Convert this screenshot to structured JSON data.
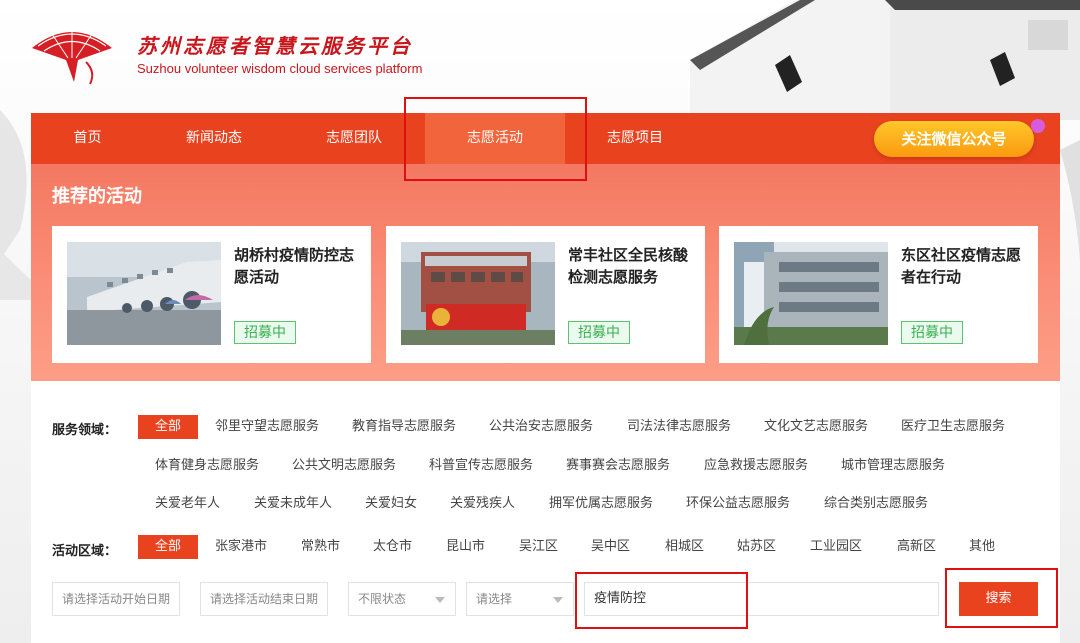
{
  "header": {
    "title_cn": "苏州志愿者智慧云服务平台",
    "title_en": "Suzhou volunteer wisdom cloud services platform",
    "logo_icon": "fan-logo-icon"
  },
  "nav": {
    "items": [
      {
        "label": "首页"
      },
      {
        "label": "新闻动态"
      },
      {
        "label": "志愿团队"
      },
      {
        "label": "志愿活动"
      },
      {
        "label": "志愿项目"
      }
    ],
    "active_index": 3,
    "wechat_button": "关注微信公众号"
  },
  "recommended": {
    "title": "推荐的活动",
    "cards": [
      {
        "title": "胡桥村疫情防控志愿活动",
        "status": "招募中"
      },
      {
        "title": "常丰社区全民核酸检测志愿服务",
        "status": "招募中"
      },
      {
        "title": "东区社区疫情志愿者在行动",
        "status": "招募中"
      }
    ]
  },
  "filters": {
    "service_label": "服务领域：",
    "service_all": "全部",
    "service_row1": [
      "邻里守望志愿服务",
      "教育指导志愿服务",
      "公共治安志愿服务",
      "司法法律志愿服务",
      "文化文艺志愿服务",
      "医疗卫生志愿服务"
    ],
    "service_row2": [
      "体育健身志愿服务",
      "公共文明志愿服务",
      "科普宣传志愿服务",
      "赛事赛会志愿服务",
      "应急救援志愿服务",
      "城市管理志愿服务"
    ],
    "service_row3": [
      "关爱老年人",
      "关爱未成年人",
      "关爱妇女",
      "关爱残疾人",
      "拥军优属志愿服务",
      "环保公益志愿服务",
      "综合类别志愿服务"
    ],
    "area_label": "活动区域：",
    "area_all": "全部",
    "areas": [
      "张家港市",
      "常熟市",
      "太仓市",
      "昆山市",
      "吴江区",
      "吴中区",
      "相城区",
      "姑苏区",
      "工业园区",
      "高新区",
      "其他"
    ]
  },
  "search": {
    "start_date_placeholder": "请选择活动开始日期",
    "end_date_placeholder": "请选择活动结束日期",
    "status_select": "不限状态",
    "type_select": "请选择",
    "keyword_value": "疫情防控",
    "button": "搜索"
  },
  "colors": {
    "primary": "#e8421f",
    "highlight_box": "#e01010",
    "badge_green": "#3bb04f"
  }
}
